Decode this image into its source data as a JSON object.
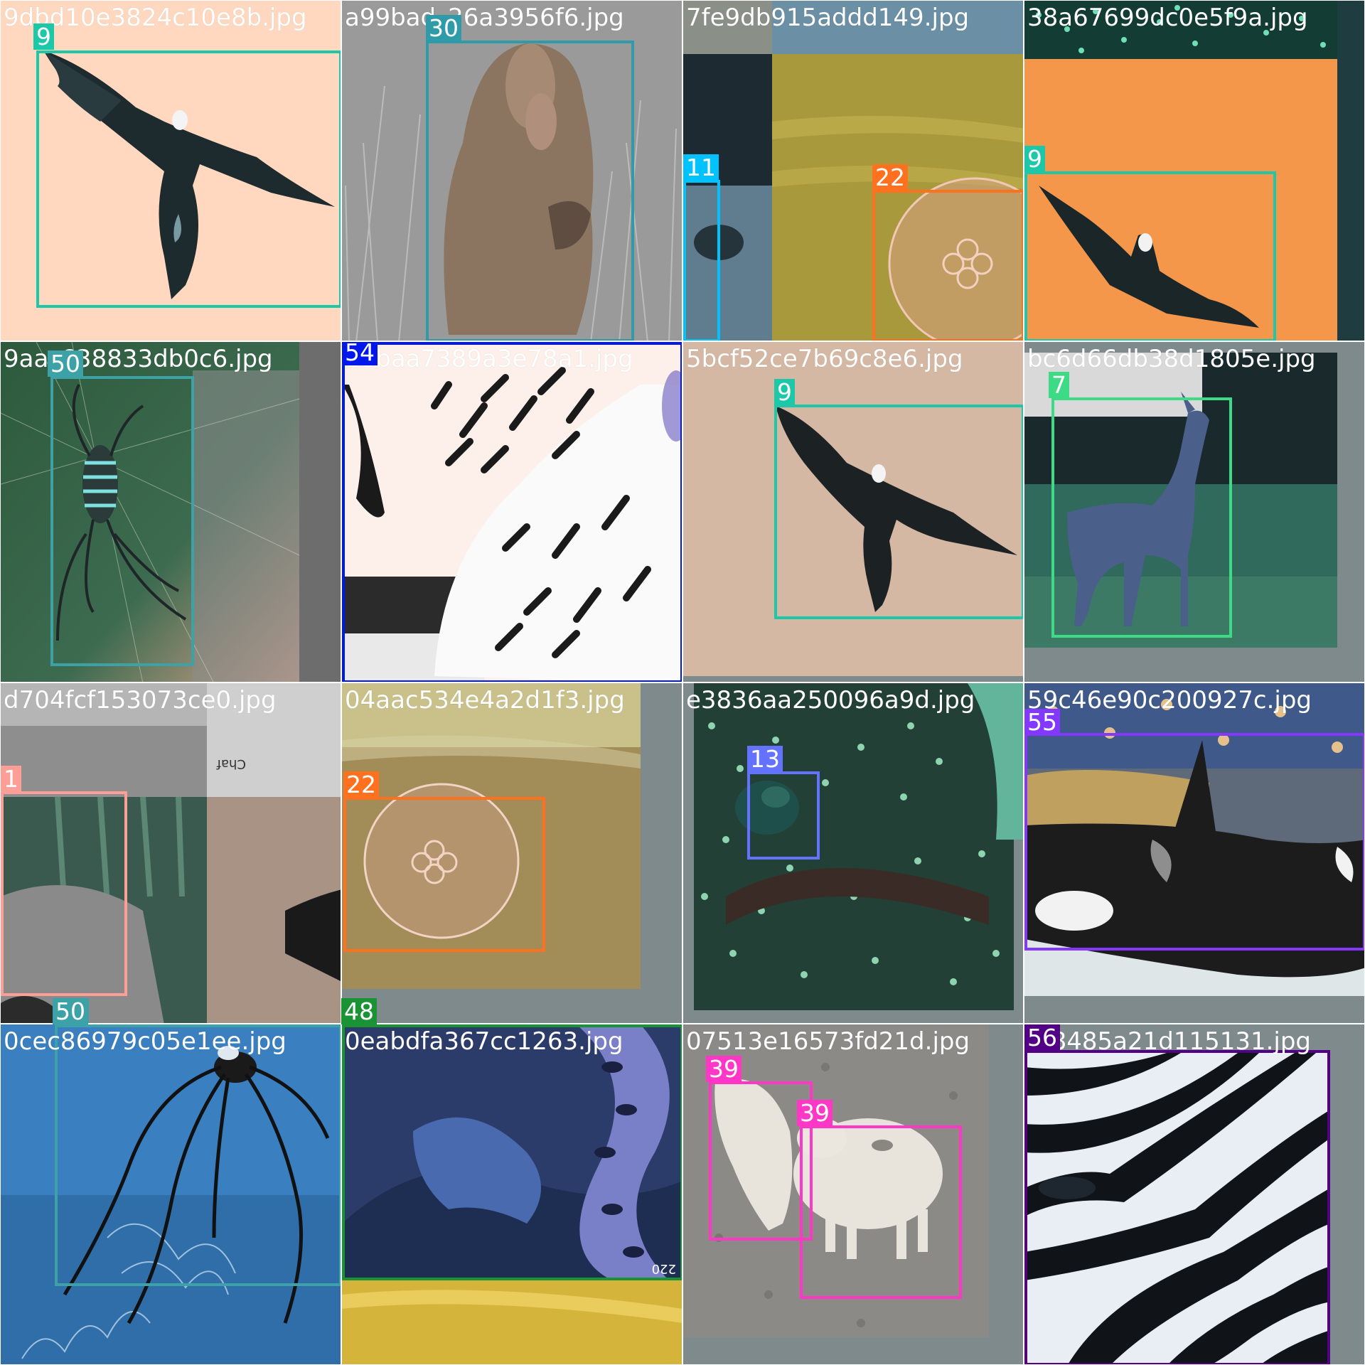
{
  "palette": {
    "1": "#FF9D97",
    "7": "#3DDB86",
    "9": "#1CC8A7",
    "11": "#00C2FF",
    "13": "#6473FF",
    "22": "#FF701F",
    "30": "#2F9BA8",
    "39": "#FF37C7",
    "48": "#1A9334",
    "50": "#3DA1A8",
    "54": "#0018EC",
    "55": "#8438FF",
    "56": "#520085"
  },
  "tiles": [
    {
      "filename": "9dbd10e3824c10e8b.jpg",
      "scene": "eagle-peach",
      "labels": [
        "9"
      ]
    },
    {
      "filename": "a99bad_26a3956f6.jpg",
      "scene": "baboon",
      "labels": [
        "30"
      ]
    },
    {
      "filename": "7fe9db915addd149.jpg",
      "scene": "mosaic-jelly",
      "labels": [
        "11",
        "22"
      ]
    },
    {
      "filename": "38a67699dc0e5f9a.jpg",
      "scene": "eagle-orange",
      "labels": [
        "9"
      ]
    },
    {
      "filename": "9aa_638833db0c6.jpg",
      "scene": "spider-green",
      "labels": [
        "50"
      ]
    },
    {
      "filename": "18baa7389a3e78a1.jpg",
      "scene": "feathers",
      "labels": [
        "54"
      ]
    },
    {
      "filename": "5bcf52ce7b69c8e6.jpg",
      "scene": "eagle-tan",
      "labels": [
        "9"
      ]
    },
    {
      "filename": "bc6d66db38d1805e.jpg",
      "scene": "deer",
      "labels": [
        "7"
      ]
    },
    {
      "filename": "d704fcf153073ce0.jpg",
      "scene": "mosaic-rocks",
      "labels": [
        "1",
        "50"
      ],
      "sign_text": "Chaf"
    },
    {
      "filename": "04aac534e4a2d1f3.jpg",
      "scene": "jellyfish",
      "labels": [
        "22"
      ]
    },
    {
      "filename": "e3836aa250096a9d.jpg",
      "scene": "frog",
      "labels": [
        "13"
      ]
    },
    {
      "filename": "59c46e90c200927c.jpg",
      "scene": "orca",
      "labels": [
        "55"
      ]
    },
    {
      "filename": "0cec86979c05e1ee.jpg",
      "scene": "spider-blue",
      "labels": [
        "50"
      ]
    },
    {
      "filename": "0eabdfa367cc1263.jpg",
      "scene": "snake",
      "labels": [
        "48"
      ],
      "corner_text": "220"
    },
    {
      "filename": "07513e16573fd21d.jpg",
      "scene": "pigs",
      "labels": [
        "39",
        "39"
      ]
    },
    {
      "filename": "f28485a21d115131.jpg",
      "scene": "zebra",
      "labels": [
        "56"
      ]
    }
  ]
}
